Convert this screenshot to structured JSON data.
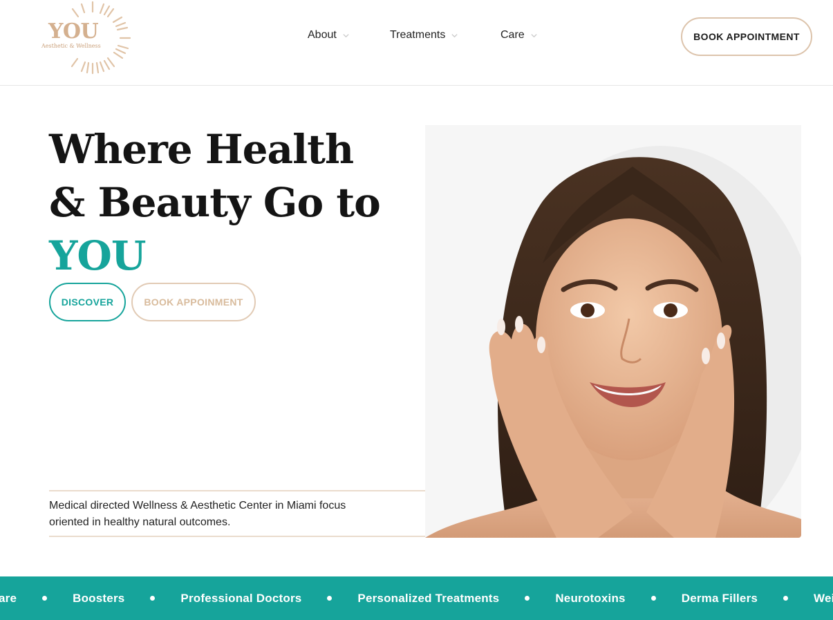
{
  "brand": {
    "name": "YOU",
    "tagline": "Aesthetic & Wellness",
    "accent_color": "#16a49b",
    "gold_color": "#d4b08f"
  },
  "nav": {
    "items": [
      {
        "label": "About",
        "icon": "chevron-down-icon"
      },
      {
        "label": "Treatments",
        "icon": "chevron-down-icon"
      },
      {
        "label": "Care",
        "icon": "chevron-down-icon"
      }
    ],
    "cta_label": "BOOK APPOINTMENT"
  },
  "hero": {
    "title_line1": "Where Health",
    "title_line2": "& Beauty Go to",
    "title_accent": "YOU",
    "discover_label": "DISCOVER",
    "book_label": "BOOK APPOINMENT",
    "description": "Medical directed Wellness & Aesthetic Center in Miami focus oriented in healthy natural outcomes."
  },
  "ticker": {
    "items": [
      "are",
      "Boosters",
      "Professional Doctors",
      "Personalized Treatments",
      "Neurotoxins",
      "Derma Fillers",
      "Weight"
    ]
  }
}
